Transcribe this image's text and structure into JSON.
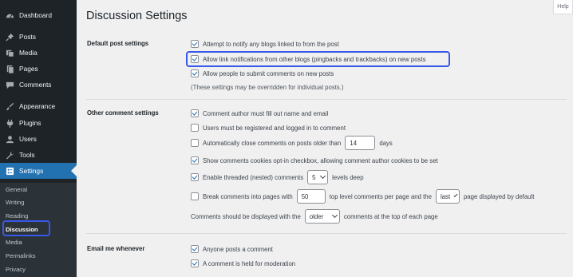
{
  "sidebar": {
    "menu": [
      {
        "label": "Dashboard",
        "icon": "dashboard-icon"
      },
      {
        "label": "Posts",
        "icon": "pin-icon"
      },
      {
        "label": "Media",
        "icon": "media-icon"
      },
      {
        "label": "Pages",
        "icon": "pages-icon"
      },
      {
        "label": "Comments",
        "icon": "comments-icon"
      },
      {
        "label": "Appearance",
        "icon": "brush-icon"
      },
      {
        "label": "Plugins",
        "icon": "plug-icon"
      },
      {
        "label": "Users",
        "icon": "user-icon"
      },
      {
        "label": "Tools",
        "icon": "wrench-icon"
      },
      {
        "label": "Settings",
        "icon": "settings-icon"
      }
    ],
    "submenu": [
      "General",
      "Writing",
      "Reading",
      "Discussion",
      "Media",
      "Permalinks",
      "Privacy"
    ],
    "current_submenu": "Discussion"
  },
  "header": {
    "title": "Discussion Settings",
    "help_label": "Help"
  },
  "default_post_settings": {
    "label": "Default post settings",
    "options": [
      {
        "text": "Attempt to notify any blogs linked to from the post",
        "checked": true
      },
      {
        "text": "Allow link notifications from other blogs (pingbacks and trackbacks) on new posts",
        "checked": true
      },
      {
        "text": "Allow people to submit comments on new posts",
        "checked": true
      }
    ],
    "note": "(These settings may be overridden for individual posts.)"
  },
  "other_comment_settings": {
    "label": "Other comment settings",
    "author_info": {
      "text": "Comment author must fill out name and email",
      "checked": true
    },
    "registered": {
      "text": "Users must be registered and logged in to comment",
      "checked": false
    },
    "auto_close": {
      "prefix": "Automatically close comments on posts older than",
      "value": "14",
      "suffix": "days",
      "checked": false
    },
    "cookies": {
      "text": "Show comments cookies opt-in checkbox, allowing comment author cookies to be set",
      "checked": true
    },
    "threaded": {
      "prefix": "Enable threaded (nested) comments",
      "value": "5",
      "suffix": "levels deep",
      "checked": true
    },
    "paged": {
      "prefix": "Break comments into pages with",
      "value": "50",
      "middle": "top level comments per page and the",
      "page_select": "last",
      "suffix": "page displayed by default",
      "checked": false
    },
    "order": {
      "prefix": "Comments should be displayed with the",
      "value": "older",
      "suffix": "comments at the top of each page"
    }
  },
  "email_me": {
    "label": "Email me whenever",
    "options": [
      {
        "text": "Anyone posts a comment",
        "checked": true
      },
      {
        "text": "A comment is held for moderation",
        "checked": true
      }
    ]
  },
  "colors": {
    "accent": "#2271b1",
    "highlight": "#3858e9",
    "sidebar": "#1d2327",
    "submenu": "#2c3338"
  }
}
